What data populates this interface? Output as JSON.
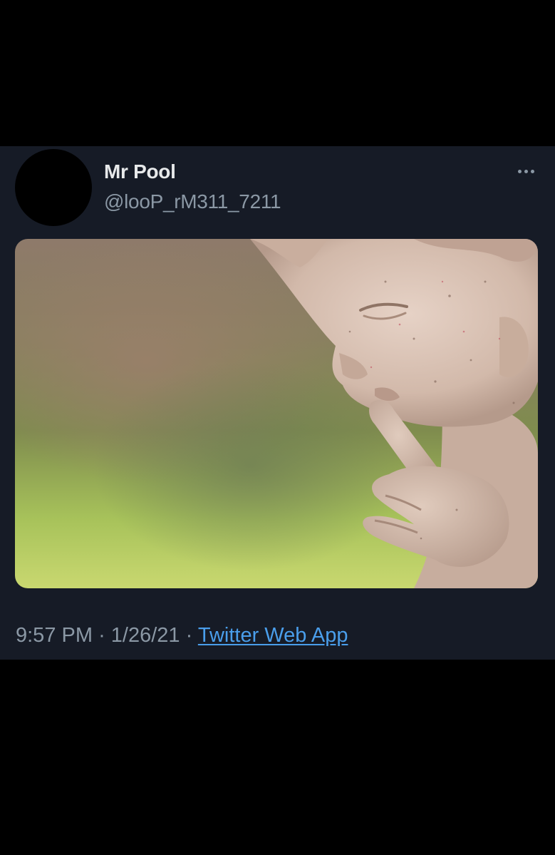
{
  "tweet": {
    "author": {
      "display_name": "Mr Pool",
      "handle": "@looP_rM311_7211",
      "avatar_icon": "avatar-placeholder"
    },
    "more_icon": "more-dots-icon",
    "media": {
      "kind": "image",
      "subject": "statue-shush-photo"
    },
    "time": "9:57 PM",
    "separator": "·",
    "date": "1/26/21",
    "source": "Twitter Web App"
  },
  "colors": {
    "page_background": "#000000",
    "card_background": "#161b26",
    "name_text": "#e7e9ea",
    "secondary_text": "#8b98a5",
    "link": "#4a9eeb"
  }
}
